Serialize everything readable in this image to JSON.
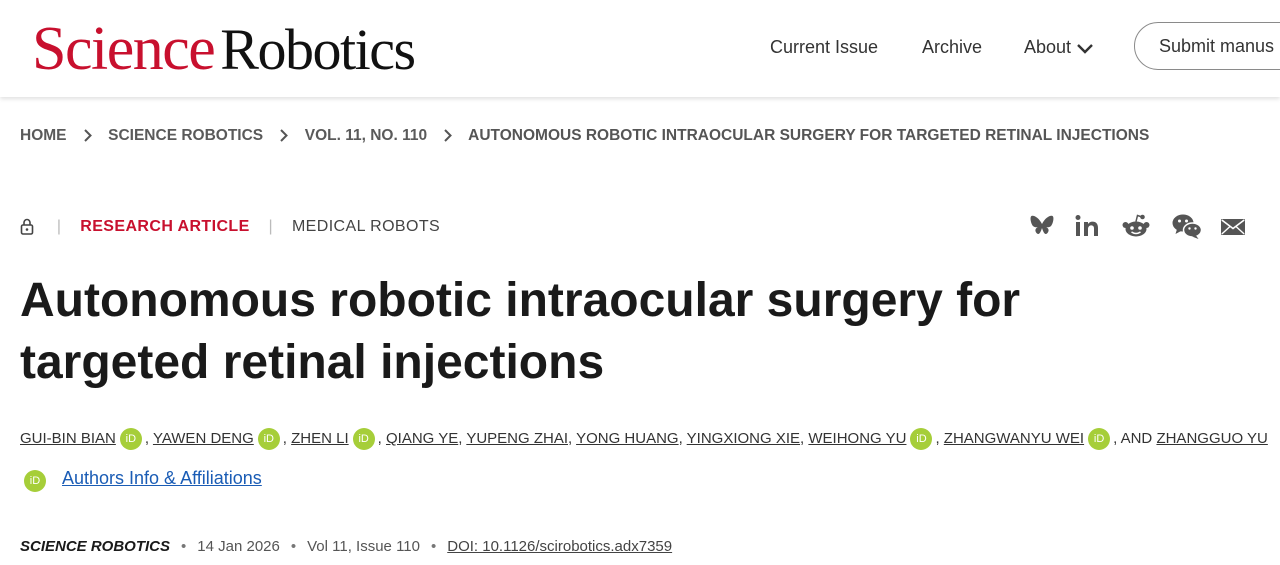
{
  "header": {
    "logo_science": "Science",
    "logo_robotics": "Robotics",
    "nav": {
      "current_issue": "Current Issue",
      "archive": "Archive",
      "about": "About"
    },
    "submit_label": "Submit manus"
  },
  "breadcrumb": [
    "HOME",
    "SCIENCE ROBOTICS",
    "VOL. 11, NO. 110",
    "AUTONOMOUS ROBOTIC INTRAOCULAR SURGERY FOR TARGETED RETINAL INJECTIONS"
  ],
  "meta": {
    "article_type": "RESEARCH ARTICLE",
    "subject": "MEDICAL ROBOTS",
    "separator": "|"
  },
  "share_icons": [
    "bluesky-icon",
    "linkedin-icon",
    "reddit-icon",
    "wechat-icon",
    "email-icon"
  ],
  "title": "Autonomous robotic intraocular surgery for targeted retinal injections",
  "authors": {
    "names": [
      "GUI-BIN BIAN",
      "YAWEN DENG",
      "ZHEN LI",
      "QIANG YE",
      "YUPENG ZHAI",
      "YONG HUANG",
      "YINGXIONG XIE",
      "WEIHONG YU",
      "ZHANGWANYU WEI",
      "ZHANGGUO YU"
    ],
    "orcid_label": "iD",
    "comma": ",",
    "and_label": ", AND",
    "affiliations_link": "Authors Info & Affiliations"
  },
  "pubinfo": {
    "journal": "SCIENCE ROBOTICS",
    "date": "14 Jan 2026",
    "volume_issue": "Vol 11, Issue 110",
    "doi": "DOI: 10.1126/scirobotics.adx7359",
    "bullet": "•"
  },
  "colors": {
    "brand_red": "#c8102e",
    "orcid_green": "#a6ce39",
    "link_blue": "#1a5cb5"
  }
}
